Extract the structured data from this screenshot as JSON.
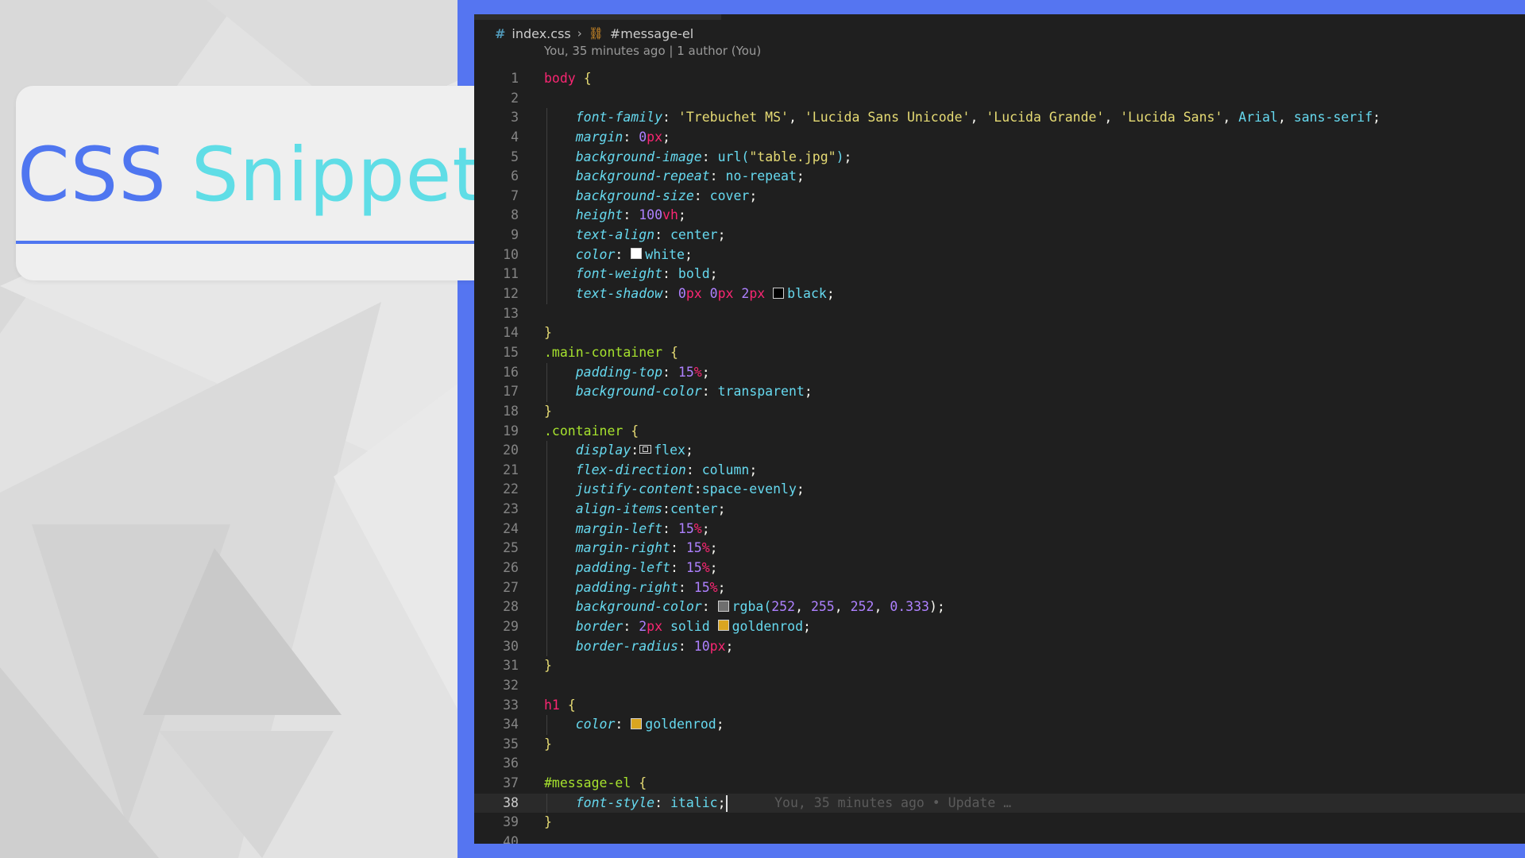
{
  "title_card": {
    "word1": "CSS",
    "word2": "Snippet"
  },
  "editor": {
    "breadcrumb": {
      "file": "index.css",
      "symbol": "#message-el"
    },
    "blame_header": "You, 35 minutes ago | 1 author (You)",
    "active_line": 38,
    "inline_blame": "You, 35 minutes ago • Update …",
    "lines": [
      [
        [
          "body",
          "cr"
        ],
        [
          " ",
          ""
        ],
        [
          "{",
          "cb"
        ]
      ],
      [],
      [
        [
          "    ",
          ""
        ],
        [
          "font-family",
          "cp"
        ],
        [
          ": ",
          "cpun"
        ],
        [
          "'Trebuchet MS'",
          "cs"
        ],
        [
          ", ",
          "cpun"
        ],
        [
          "'Lucida Sans Unicode'",
          "cs"
        ],
        [
          ", ",
          "cpun"
        ],
        [
          "'Lucida Grande'",
          "cs"
        ],
        [
          ", ",
          "cpun"
        ],
        [
          "'Lucida Sans'",
          "cs"
        ],
        [
          ", ",
          "cpun"
        ],
        [
          "Arial",
          "cv"
        ],
        [
          ", ",
          "cpun"
        ],
        [
          "sans-serif",
          "cv"
        ],
        [
          ";",
          "cpun"
        ]
      ],
      [
        [
          "    ",
          ""
        ],
        [
          "margin",
          "cp"
        ],
        [
          ": ",
          "cpun"
        ],
        [
          "0",
          "cn"
        ],
        [
          "px",
          "cu"
        ],
        [
          ";",
          "cpun"
        ]
      ],
      [
        [
          "    ",
          ""
        ],
        [
          "background-image",
          "cp"
        ],
        [
          ": ",
          "cpun"
        ],
        [
          "url(",
          "cv"
        ],
        [
          "\"table.jpg\"",
          "cs"
        ],
        [
          ")",
          "cv"
        ],
        [
          ";",
          "cpun"
        ]
      ],
      [
        [
          "    ",
          ""
        ],
        [
          "background-repeat",
          "cp"
        ],
        [
          ": ",
          "cpun"
        ],
        [
          "no-repeat",
          "cv"
        ],
        [
          ";",
          "cpun"
        ]
      ],
      [
        [
          "    ",
          ""
        ],
        [
          "background-size",
          "cp"
        ],
        [
          ": ",
          "cpun"
        ],
        [
          "cover",
          "cv"
        ],
        [
          ";",
          "cpun"
        ]
      ],
      [
        [
          "    ",
          ""
        ],
        [
          "height",
          "cp"
        ],
        [
          ": ",
          "cpun"
        ],
        [
          "100",
          "cn"
        ],
        [
          "vh",
          "cu"
        ],
        [
          ";",
          "cpun"
        ]
      ],
      [
        [
          "    ",
          ""
        ],
        [
          "text-align",
          "cp"
        ],
        [
          ": ",
          "cpun"
        ],
        [
          "center",
          "cv"
        ],
        [
          ";",
          "cpun"
        ]
      ],
      [
        [
          "    ",
          ""
        ],
        [
          "color",
          "cp"
        ],
        [
          ": ",
          "cpun"
        ],
        [
          "#ffffff",
          "swatch"
        ],
        [
          "white",
          "cv"
        ],
        [
          ";",
          "cpun"
        ]
      ],
      [
        [
          "    ",
          ""
        ],
        [
          "font-weight",
          "cp"
        ],
        [
          ": ",
          "cpun"
        ],
        [
          "bold",
          "cv"
        ],
        [
          ";",
          "cpun"
        ]
      ],
      [
        [
          "    ",
          ""
        ],
        [
          "text-shadow",
          "cp"
        ],
        [
          ": ",
          "cpun"
        ],
        [
          "0",
          "cn"
        ],
        [
          "px",
          "cu"
        ],
        [
          " ",
          ""
        ],
        [
          "0",
          "cn"
        ],
        [
          "px",
          "cu"
        ],
        [
          " ",
          ""
        ],
        [
          "2",
          "cn"
        ],
        [
          "px",
          "cu"
        ],
        [
          " ",
          ""
        ],
        [
          "#000000",
          "swatch"
        ],
        [
          "black",
          "cv"
        ],
        [
          ";",
          "cpun"
        ]
      ],
      [],
      [
        [
          "}",
          "cb"
        ]
      ],
      [
        [
          ".main-container",
          "cg"
        ],
        [
          " ",
          ""
        ],
        [
          "{",
          "cb"
        ]
      ],
      [
        [
          "    ",
          ""
        ],
        [
          "padding-top",
          "cp"
        ],
        [
          ": ",
          "cpun"
        ],
        [
          "15",
          "cn"
        ],
        [
          "%",
          "cu"
        ],
        [
          ";",
          "cpun"
        ]
      ],
      [
        [
          "    ",
          ""
        ],
        [
          "background-color",
          "cp"
        ],
        [
          ": ",
          "cpun"
        ],
        [
          "transparent",
          "cv"
        ],
        [
          ";",
          "cpun"
        ]
      ],
      [
        [
          "}",
          "cb"
        ]
      ],
      [
        [
          ".container",
          "cg"
        ],
        [
          " ",
          ""
        ],
        [
          "{",
          "cb"
        ]
      ],
      [
        [
          "    ",
          ""
        ],
        [
          "display",
          "cp"
        ],
        [
          ":",
          "cpun"
        ],
        [
          "flex",
          "flexicon"
        ],
        [
          "flex",
          "cv"
        ],
        [
          ";",
          "cpun"
        ]
      ],
      [
        [
          "    ",
          ""
        ],
        [
          "flex-direction",
          "cp"
        ],
        [
          ": ",
          "cpun"
        ],
        [
          "column",
          "cv"
        ],
        [
          ";",
          "cpun"
        ]
      ],
      [
        [
          "    ",
          ""
        ],
        [
          "justify-content",
          "cp"
        ],
        [
          ":",
          "cpun"
        ],
        [
          "space-evenly",
          "cv"
        ],
        [
          ";",
          "cpun"
        ]
      ],
      [
        [
          "    ",
          ""
        ],
        [
          "align-items",
          "cp"
        ],
        [
          ":",
          "cpun"
        ],
        [
          "center",
          "cv"
        ],
        [
          ";",
          "cpun"
        ]
      ],
      [
        [
          "    ",
          ""
        ],
        [
          "margin-left",
          "cp"
        ],
        [
          ": ",
          "cpun"
        ],
        [
          "15",
          "cn"
        ],
        [
          "%",
          "cu"
        ],
        [
          ";",
          "cpun"
        ]
      ],
      [
        [
          "    ",
          ""
        ],
        [
          "margin-right",
          "cp"
        ],
        [
          ": ",
          "cpun"
        ],
        [
          "15",
          "cn"
        ],
        [
          "%",
          "cu"
        ],
        [
          ";",
          "cpun"
        ]
      ],
      [
        [
          "    ",
          ""
        ],
        [
          "padding-left",
          "cp"
        ],
        [
          ": ",
          "cpun"
        ],
        [
          "15",
          "cn"
        ],
        [
          "%",
          "cu"
        ],
        [
          ";",
          "cpun"
        ]
      ],
      [
        [
          "    ",
          ""
        ],
        [
          "padding-right",
          "cp"
        ],
        [
          ": ",
          "cpun"
        ],
        [
          "15",
          "cn"
        ],
        [
          "%",
          "cu"
        ],
        [
          ";",
          "cpun"
        ]
      ],
      [
        [
          "    ",
          ""
        ],
        [
          "background-color",
          "cp"
        ],
        [
          ": ",
          "cpun"
        ],
        [
          "#6f6f6f",
          "swatch"
        ],
        [
          "rgba(",
          "cv"
        ],
        [
          "252",
          "cn"
        ],
        [
          ", ",
          "cpun"
        ],
        [
          "255",
          "cn"
        ],
        [
          ", ",
          "cpun"
        ],
        [
          "252",
          "cn"
        ],
        [
          ", ",
          "cpun"
        ],
        [
          "0.333",
          "cn"
        ],
        [
          ");",
          "cpun"
        ]
      ],
      [
        [
          "    ",
          ""
        ],
        [
          "border",
          "cp"
        ],
        [
          ": ",
          "cpun"
        ],
        [
          "2",
          "cn"
        ],
        [
          "px",
          "cu"
        ],
        [
          " ",
          ""
        ],
        [
          "solid",
          "cv"
        ],
        [
          " ",
          ""
        ],
        [
          "#daa520",
          "swatch"
        ],
        [
          "goldenrod",
          "cv"
        ],
        [
          ";",
          "cpun"
        ]
      ],
      [
        [
          "    ",
          ""
        ],
        [
          "border-radius",
          "cp"
        ],
        [
          ": ",
          "cpun"
        ],
        [
          "10",
          "cn"
        ],
        [
          "px",
          "cu"
        ],
        [
          ";",
          "cpun"
        ]
      ],
      [
        [
          "}",
          "cb"
        ]
      ],
      [],
      [
        [
          "h1",
          "cr"
        ],
        [
          " ",
          ""
        ],
        [
          "{",
          "cb"
        ]
      ],
      [
        [
          "    ",
          ""
        ],
        [
          "color",
          "cp"
        ],
        [
          ": ",
          "cpun"
        ],
        [
          "#daa520",
          "swatch"
        ],
        [
          "goldenrod",
          "cv"
        ],
        [
          ";",
          "cpun"
        ]
      ],
      [
        [
          "}",
          "cb"
        ]
      ],
      [],
      [
        [
          "#message-el",
          "cg"
        ],
        [
          " ",
          ""
        ],
        [
          "{",
          "cb"
        ]
      ],
      [
        [
          "    ",
          ""
        ],
        [
          "font-style",
          "cp"
        ],
        [
          ": ",
          "cpun"
        ],
        [
          "italic",
          "cv"
        ],
        [
          ";",
          "cpun"
        ]
      ],
      [
        [
          "}",
          "cb"
        ]
      ],
      []
    ]
  }
}
